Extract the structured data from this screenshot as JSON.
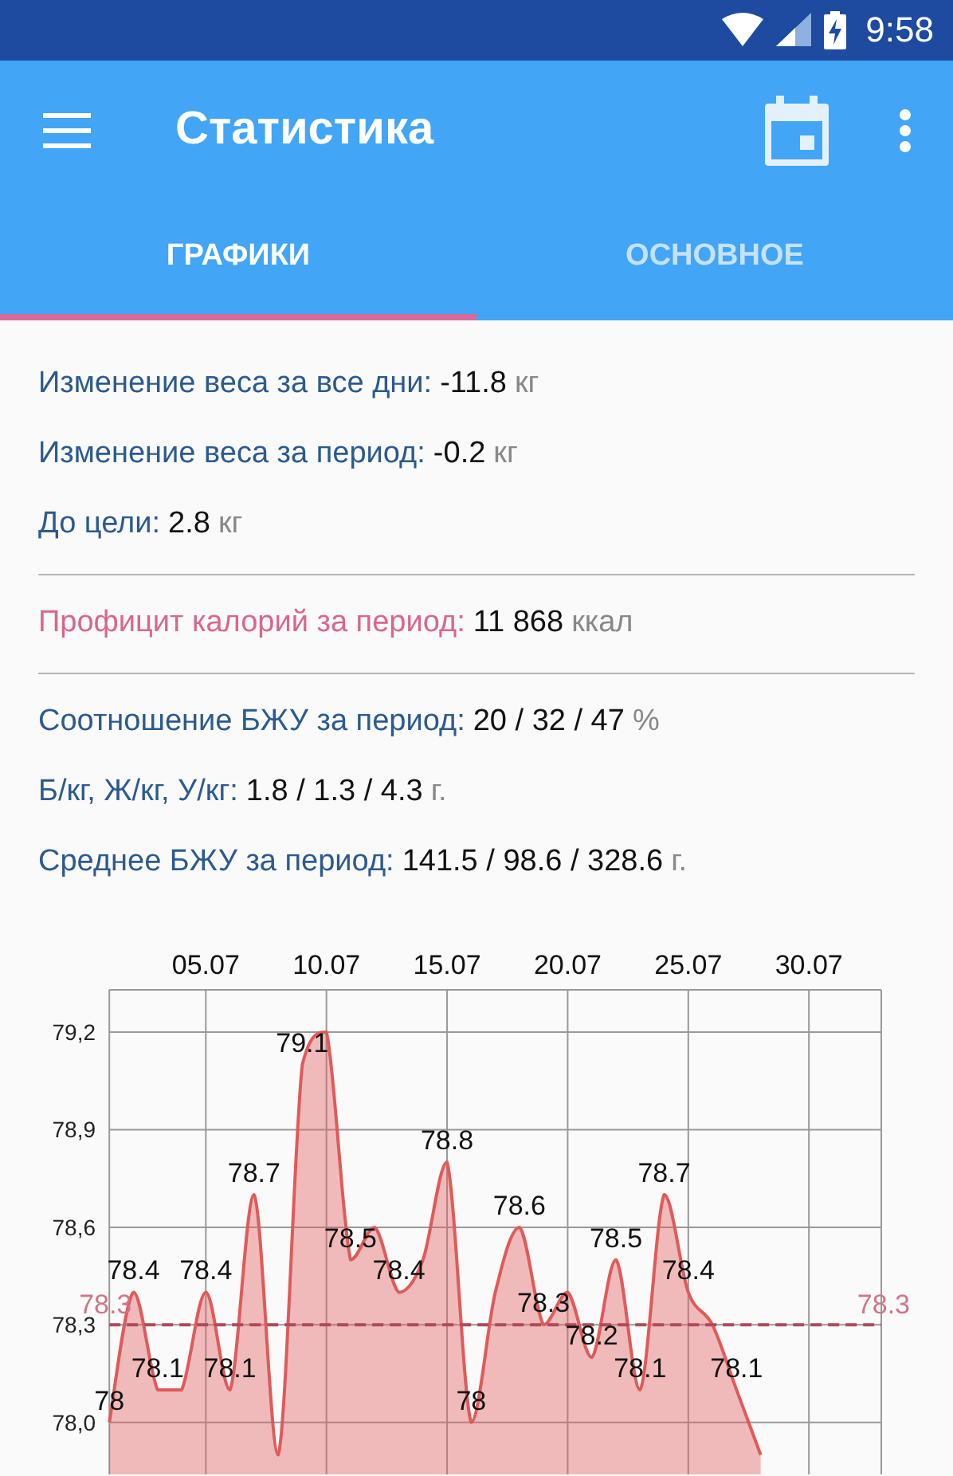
{
  "status_bar": {
    "time": "9:58"
  },
  "toolbar": {
    "title": "Статистика"
  },
  "tabs": [
    {
      "label": "ГРАФИКИ",
      "selected": true
    },
    {
      "label": "ОСНОВНОЕ",
      "selected": false
    }
  ],
  "stat_groups": [
    {
      "rows": [
        {
          "kind": "plain",
          "label": "Изменение веса за все дни:",
          "value": "-11.8",
          "unit": "кг"
        },
        {
          "kind": "plain",
          "label": "Изменение веса за период:",
          "value": "-0.2",
          "unit": "кг"
        },
        {
          "kind": "plain",
          "label": "До цели:",
          "value": "2.8",
          "unit": "кг"
        }
      ]
    },
    {
      "rows": [
        {
          "kind": "accent",
          "label": "Профицит калорий за период:",
          "value": "11 868",
          "unit": "ккал"
        }
      ]
    },
    {
      "rows": [
        {
          "kind": "plain",
          "label": "Соотношение БЖУ за период:",
          "value": "20 / 32 / 47",
          "unit": "%"
        },
        {
          "kind": "plain",
          "label": "Б/кг, Ж/кг, У/кг:",
          "value": "1.8 / 1.3 / 4.3",
          "unit": "г."
        },
        {
          "kind": "plain",
          "label": "Среднее БЖУ за период:",
          "value": "141.5 / 98.6 / 328.6",
          "unit": "г."
        }
      ]
    }
  ],
  "weight_chart": {
    "chart_data": {
      "type": "area",
      "categories": [
        null,
        null,
        null,
        null,
        "05.07",
        null,
        null,
        null,
        null,
        "10.07",
        null,
        null,
        null,
        null,
        "15.07",
        null,
        null,
        null,
        null,
        "20.07",
        null,
        null,
        null,
        null,
        "25.07",
        null,
        null,
        null,
        null,
        "30.07",
        null,
        null
      ],
      "series": [
        {
          "color": "#e05a5a",
          "values": [
            78.0,
            78.4,
            78.1,
            78.1,
            78.4,
            78.1,
            78.7,
            77.9,
            79.1,
            79.2,
            78.5,
            78.6,
            78.4,
            78.5,
            78.8,
            78.0,
            78.4,
            78.6,
            78.3,
            78.4,
            78.2,
            78.5,
            78.1,
            78.7,
            78.4,
            78.3,
            78.1,
            77.9,
            null,
            null,
            null,
            null
          ]
        }
      ],
      "value_labels": [
        "78",
        "78.4",
        "78.1",
        null,
        "78.4",
        "78.1",
        "78.7",
        null,
        "79.1",
        null,
        "78.5",
        null,
        "78.4",
        null,
        "78.8",
        "78",
        null,
        "78.6",
        "78.3",
        null,
        "78.2",
        "78.5",
        "78.1",
        "78.7",
        "78.4",
        null,
        "78.1",
        null,
        null,
        null,
        null,
        null
      ],
      "ylim": [
        77.84,
        79.33
      ],
      "yticks": [
        {
          "value": 78.0,
          "label": "78,0"
        },
        {
          "value": 78.3,
          "label": "78,3"
        },
        {
          "value": 78.6,
          "label": "78,6"
        },
        {
          "value": 78.9,
          "label": "78,9"
        },
        {
          "value": 79.2,
          "label": "79,2"
        }
      ],
      "grid": true,
      "ref_lines": [
        {
          "axis": "y",
          "value": 78.3,
          "label": "78.3",
          "color": "#b04a5a"
        }
      ],
      "annotations": [
        "78.3"
      ]
    }
  }
}
